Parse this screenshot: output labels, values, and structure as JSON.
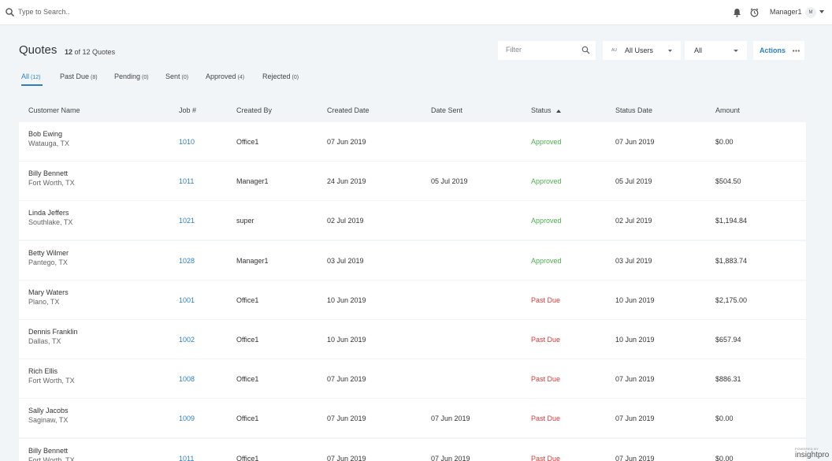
{
  "search": {
    "placeholder": "Type to Search.."
  },
  "user": {
    "name": "Manager1",
    "initial": "M"
  },
  "page": {
    "title": "Quotes",
    "count_bold": "12",
    "count_rest": "of 12 Quotes"
  },
  "filter": {
    "placeholder": "Filter"
  },
  "users_select": {
    "badge": "AU",
    "label": "All Users"
  },
  "status_select": {
    "label": "All"
  },
  "actions": {
    "label": "Actions"
  },
  "tabs": [
    {
      "label": "All",
      "count": "(12)"
    },
    {
      "label": "Past Due",
      "count": "(8)"
    },
    {
      "label": "Pending",
      "count": "(0)"
    },
    {
      "label": "Sent",
      "count": "(0)"
    },
    {
      "label": "Approved",
      "count": "(4)"
    },
    {
      "label": "Rejected",
      "count": "(0)"
    }
  ],
  "columns": [
    "Customer Name",
    "Job #",
    "Created By",
    "Created Date",
    "Date Sent",
    "Status",
    "Status Date",
    "Amount"
  ],
  "rows": [
    {
      "name": "Bob Ewing",
      "location": "Watauga, TX",
      "job": "1010",
      "created_by": "Office1",
      "created_date": "07 Jun 2019",
      "date_sent": "",
      "status": "Approved",
      "status_date": "07 Jun 2019",
      "amount": "$0.00"
    },
    {
      "name": "Billy Bennett",
      "location": "Fort Worth, TX",
      "job": "1011",
      "created_by": "Manager1",
      "created_date": "24 Jun 2019",
      "date_sent": "05 Jul 2019",
      "status": "Approved",
      "status_date": "05 Jul 2019",
      "amount": "$504.50"
    },
    {
      "name": "Linda Jeffers",
      "location": "Southlake, TX",
      "job": "1021",
      "created_by": "super",
      "created_date": "02 Jul 2019",
      "date_sent": "",
      "status": "Approved",
      "status_date": "02 Jul 2019",
      "amount": "$1,194.84"
    },
    {
      "name": "Betty Wilmer",
      "location": "Pantego, TX",
      "job": "1028",
      "created_by": "Manager1",
      "created_date": "03 Jul 2019",
      "date_sent": "",
      "status": "Approved",
      "status_date": "03 Jul 2019",
      "amount": "$1,883.74"
    },
    {
      "name": "Mary Waters",
      "location": "Plano, TX",
      "job": "1001",
      "created_by": "Office1",
      "created_date": "10 Jun 2019",
      "date_sent": "",
      "status": "Past Due",
      "status_date": "10 Jun 2019",
      "amount": "$2,175.00"
    },
    {
      "name": "Dennis Franklin",
      "location": "Dallas, TX",
      "job": "1002",
      "created_by": "Office1",
      "created_date": "10 Jun 2019",
      "date_sent": "",
      "status": "Past Due",
      "status_date": "10 Jun 2019",
      "amount": "$657.94"
    },
    {
      "name": "Rich Ellis",
      "location": "Fort Worth, TX",
      "job": "1008",
      "created_by": "Office1",
      "created_date": "07 Jun 2019",
      "date_sent": "",
      "status": "Past Due",
      "status_date": "07 Jun 2019",
      "amount": "$886.31"
    },
    {
      "name": "Sally Jacobs",
      "location": "Saginaw, TX",
      "job": "1009",
      "created_by": "Office1",
      "created_date": "07 Jun 2019",
      "date_sent": "07 Jun 2019",
      "status": "Past Due",
      "status_date": "07 Jun 2019",
      "amount": "$0.00"
    },
    {
      "name": "Billy Bennett",
      "location": "Fort Worth, TX",
      "job": "1011",
      "created_by": "Office1",
      "created_date": "07 Jun 2019",
      "date_sent": "07 Jun 2019",
      "status": "Past Due",
      "status_date": "07 Jun 2019",
      "amount": "$0.00"
    }
  ],
  "brand": {
    "small": "POWERED BY",
    "name": "insightpro"
  },
  "colors": {
    "accent": "#2f7fbf",
    "approved": "#4caf50",
    "past_due": "#d63a3a",
    "background": "#f2f5f7"
  }
}
